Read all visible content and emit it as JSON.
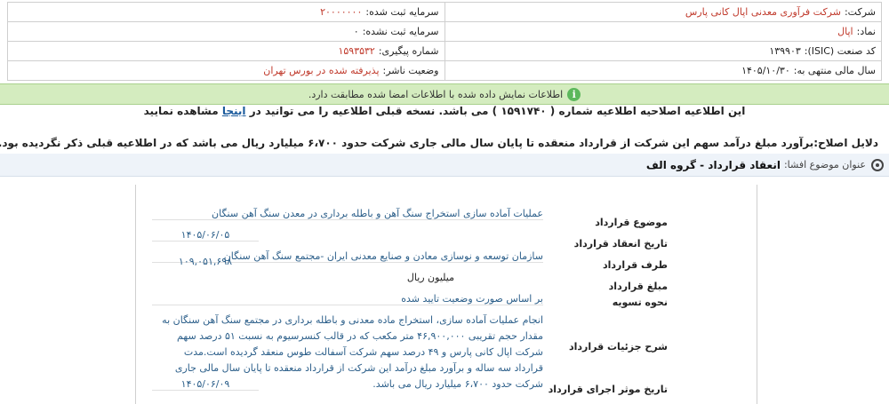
{
  "company_info": {
    "company_label": "شرکت:",
    "company_value": "شرکت فرآوری معدنی اپال کانی پارس",
    "registered_capital_label": "سرمایه ثبت شده:",
    "registered_capital_value": "۲۰۰۰۰۰۰۰",
    "symbol_label": "نماد:",
    "symbol_value": "اپال",
    "unregistered_capital_label": "سرمایه ثبت نشده:",
    "unregistered_capital_value": "۰",
    "isic_label": "کد صنعت (ISIC):",
    "isic_value": "۱۳۹۹۰۳",
    "tracking_label": "شماره پیگیری:",
    "tracking_value": "۱۵۹۳۵۳۲",
    "fiscal_year_label": "سال مالی منتهی به:",
    "fiscal_year_value": "۱۴۰۵/۱۰/۳۰",
    "publisher_status_label": "وضعیت ناشر:",
    "publisher_status_value": "پذیرفته شده در بورس تهران"
  },
  "notice": {
    "icon": "info-icon",
    "text": "اطلاعات نمایش داده شده با اطلاعات امضا شده مطابقت دارد."
  },
  "amendment": {
    "before": "این اطلاعیه اصلاحیه اطلاعیه شماره ( ۱۵۹۱۷۴۰ ) می باشد. نسخه قبلی اطلاعیه را می توانید در",
    "link": "اینجا",
    "after": "مشاهده نمایید"
  },
  "reason_text": "دلایل اصلاح:برآورد مبلغ درآمد سهم این شرکت از قرارداد منعقده تا پایان سال مالی جاری شرکت حدود ۶،۷۰۰ میلیارد ریال می باشد که در اطلاعیه قبلی ذکر نگردیده بود.",
  "subject": {
    "label": "عنوان موضوع افشا:",
    "value": "انعقاد قرارداد - گروه الف"
  },
  "details": {
    "subject_label": "موضوع قرارداد",
    "subject_value": "عملیات آماده سازی استخراج سنگ آهن و باطله برداری در معدن سنگ آهن سنگان",
    "date_label": "تاریخ انعقاد قرارداد",
    "date_value": "۱۴۰۵/۰۶/۰۵",
    "party_label": "طرف قرارداد",
    "party_value": "سازمان توسعه و نوسازی معادن و صنایع معدنی ایران -مجتمع سنگ آهن سنگان",
    "amount_label": "مبلغ قرارداد",
    "amount_value": "۱۰۹,۰۵۱,۶۹۸",
    "amount_unit": "میلیون ریال",
    "settlement_label": "نحوه تسویه",
    "settlement_value": "بر اساس صورت وضعیت تایید شده",
    "description_label": "شرح جزئیات قرارداد",
    "description_value": "انجام عملیات آماده سازی، استخراج ماده معدنی و باطله برداری در مجتمع سنگ آهن سنگان به مقدار حجم تقریبی ۴۶,۹۰۰,۰۰۰ متر مکعب که در قالب کنسرسیوم به نسبت ۵۱ درصد سهم شرکت اپال کانی پارس و ۴۹ درصد سهم شرکت آسفالت طوس منعقد گردیده است.مدت قرارداد سه ساله و برآورد مبلغ درآمد این شرکت از قرارداد منعقده تا پایان سال مالی جاری شرکت حدود ۶،۷۰۰ میلیارد ریال می باشد.",
    "effective_date_label": "تاریخ موثر اجرای قرارداد",
    "effective_date_value": "۱۴۰۵/۰۶/۰۹"
  }
}
